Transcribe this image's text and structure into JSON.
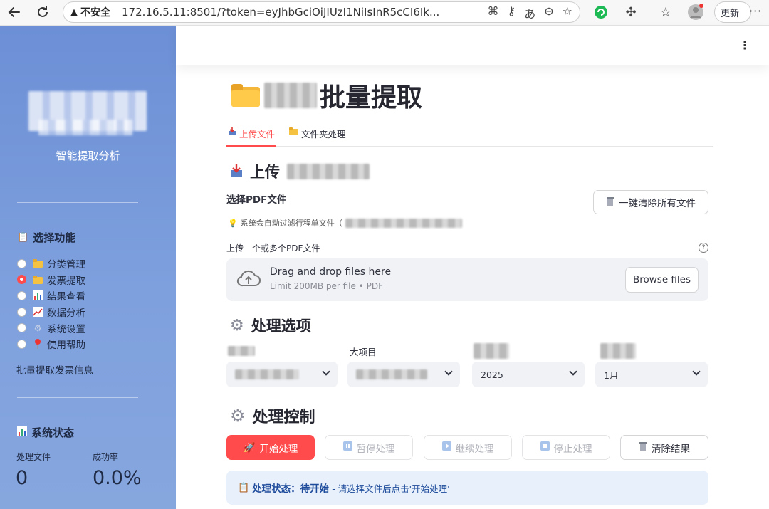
{
  "browser": {
    "insecure_label": "不安全",
    "url": "172.16.5.11:8501/?token=eyJhbGciOiJIUzI1NiIsInR5cCI6Ik...",
    "update_label": "更新"
  },
  "sidebar": {
    "subtitle": "智能提取分析",
    "function_section": "选择功能",
    "items": [
      {
        "label": "分类管理",
        "selected": false,
        "icon": "folder-icon"
      },
      {
        "label": "发票提取",
        "selected": true,
        "icon": "folder-icon"
      },
      {
        "label": "结果查看",
        "selected": false,
        "icon": "bar-chart-icon"
      },
      {
        "label": "数据分析",
        "selected": false,
        "icon": "line-chart-icon"
      },
      {
        "label": "系统设置",
        "selected": false,
        "icon": "gear-icon"
      },
      {
        "label": "使用帮助",
        "selected": false,
        "icon": "pin-icon"
      }
    ],
    "note": "批量提取发票信息",
    "status_section": "系统状态",
    "metrics": [
      {
        "label": "处理文件",
        "value": "0"
      },
      {
        "label": "成功率",
        "value": "0.0%"
      }
    ]
  },
  "main": {
    "title_suffix": "批量提取",
    "tabs": [
      {
        "label": "上传文件",
        "active": true,
        "icon": "inbox-icon"
      },
      {
        "label": "文件夹处理",
        "active": false,
        "icon": "folder-icon"
      }
    ],
    "upload_heading": "上传",
    "select_pdf_label": "选择PDF文件",
    "clear_all_label": "一键清除所有文件",
    "hint": "系统会自动过滤行程单文件（",
    "uploader_label": "上传一个或多个PDF文件",
    "drag_text": "Drag and drop files here",
    "limit_text": "Limit 200MB per file • PDF",
    "browse_label": "Browse files",
    "options_heading": "处理选项",
    "big_project_label": "大项目",
    "year_value": "2025",
    "month_value": "1月",
    "control_heading": "处理控制",
    "buttons": {
      "start": "开始处理",
      "pause": "暂停处理",
      "resume": "继续处理",
      "stop": "停止处理",
      "clear": "清除结果"
    },
    "status": {
      "title": "处理状态：待开始",
      "message": " - 请选择文件后点击'开始处理'"
    }
  },
  "colors": {
    "primary": "#ff4b4b",
    "sidebar_top": "#6c8fd6",
    "sidebar_bottom": "#86a6de",
    "status_bg": "#e8f0fb"
  }
}
